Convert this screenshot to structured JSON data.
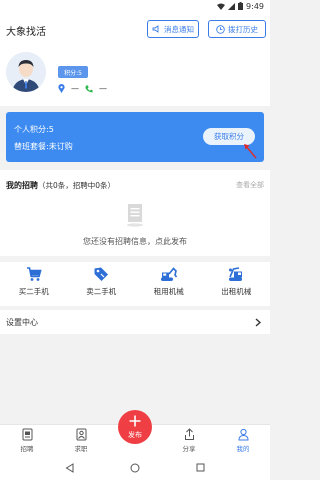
{
  "status_bar": {
    "time": "9:49"
  },
  "header": {
    "title": "大象找活",
    "notice_label": "消息通知",
    "history_label": "拨打历史"
  },
  "profile": {
    "points_badge": "积分:5",
    "location_value": "—",
    "phone_value": "—"
  },
  "points_card": {
    "points_line": "个人积分:5",
    "plan_line": "替班套餐:未订购",
    "get_points_label": "获取积分"
  },
  "recruit": {
    "title": "我的招聘",
    "count": "（共0条，招聘中0条）",
    "view_all": "查看全部",
    "empty_text": "您还没有招聘信息，点此发布"
  },
  "quick_actions": [
    {
      "label": "买二手机",
      "icon": "cart-icon"
    },
    {
      "label": "卖二手机",
      "icon": "tag-icon"
    },
    {
      "label": "租用机械",
      "icon": "excavator-icon"
    },
    {
      "label": "出租机械",
      "icon": "crane-icon"
    }
  ],
  "settings": {
    "label": "设置中心"
  },
  "tabbar": {
    "tabs": [
      {
        "label": "招聘",
        "icon": "document-icon"
      },
      {
        "label": "求职",
        "icon": "person-card-icon"
      },
      {
        "label": "发布",
        "icon": "plus-icon"
      },
      {
        "label": "分享",
        "icon": "share-icon"
      },
      {
        "label": "我的",
        "icon": "user-icon"
      }
    ]
  },
  "colors": {
    "accent": "#3a7de8",
    "card": "#3d8bf1",
    "publish": "#ef3f44"
  }
}
